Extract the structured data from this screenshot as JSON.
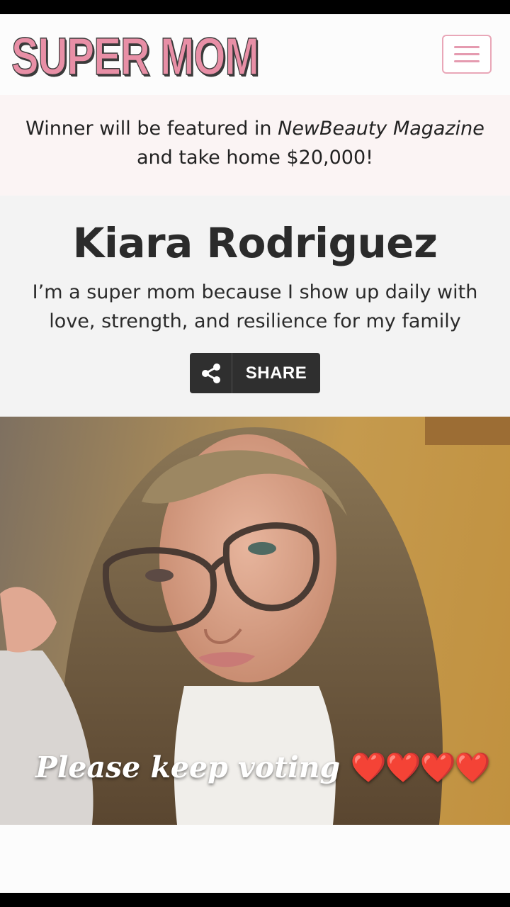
{
  "header": {
    "logo_text": "SUPER MOM",
    "menu_icon": "hamburger-menu-icon"
  },
  "promo": {
    "line1_prefix": "Winner will be featured in ",
    "line1_italic": "NewBeauty Magazine",
    "line2": "and take home $20,000!"
  },
  "profile": {
    "name": "Kiara Rodriguez",
    "tagline": "I’m a super mom because I show up daily with love, strength, and resilience for my family",
    "share_label": "SHARE",
    "share_icon": "share-icon"
  },
  "photo": {
    "caption": "Please keep voting",
    "hearts": "❤️❤️❤️❤️"
  },
  "colors": {
    "logo_pink": "#e88fa6",
    "logo_outline": "#3b3b3b",
    "share_button_bg": "#2f2f2f",
    "promo_bg": "#fbf4f4",
    "profile_bg": "#f3f3f3"
  }
}
